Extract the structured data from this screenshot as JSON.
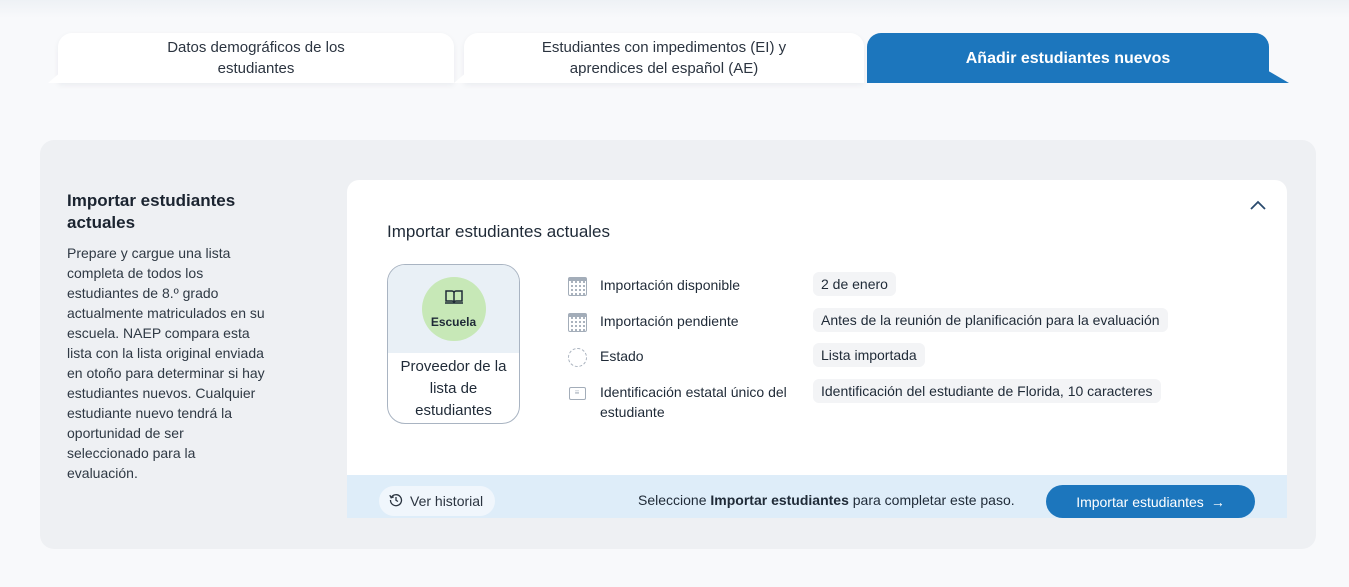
{
  "tabs": [
    {
      "line1": "Datos demográficos de los",
      "line2": "estudiantes",
      "active": false
    },
    {
      "line1": "Estudiantes con impedimentos (EI) y",
      "line2": "aprendices del español (AE)",
      "active": false
    },
    {
      "line1": "Añadir estudiantes nuevos",
      "line2": "",
      "active": true
    }
  ],
  "sidebar": {
    "title": "Importar estudiantes actuales",
    "description": "Prepare y cargue una lista completa de todos los estudiantes de 8.º grado actualmente matriculados en su escuela. NAEP compara esta lista con la lista original enviada en otoño para determinar si hay estudiantes nuevos. Cualquier estudiante nuevo tendrá la oportunidad de ser seleccionado para la evaluación."
  },
  "card": {
    "title": "Importar estudiantes actuales",
    "provider": {
      "badge": "Escuela",
      "label": "Proveedor de la lista de estudiantes"
    },
    "details": [
      {
        "icon": "calendar-icon",
        "label": "Importación disponible",
        "value": "2 de enero"
      },
      {
        "icon": "calendar-icon",
        "label": "Importación pendiente",
        "value": "Antes de la reunión de planificación para la evaluación"
      },
      {
        "icon": "status-circle-icon",
        "label": "Estado",
        "value": "Lista importada"
      },
      {
        "icon": "id-card-icon",
        "label": "Identificación estatal único del estudiante",
        "value": "Identificación del estudiante de Florida, 10 caracteres"
      }
    ],
    "footer": {
      "history_label": "Ver historial",
      "message_prefix": "Seleccione ",
      "message_bold": "Importar estudiantes",
      "message_suffix": " para completar este paso.",
      "import_button": "Importar estudiantes"
    }
  },
  "colors": {
    "accent": "#1c76bd",
    "school_badge": "#c7e8b7",
    "footer_bg": "#deedf9"
  }
}
